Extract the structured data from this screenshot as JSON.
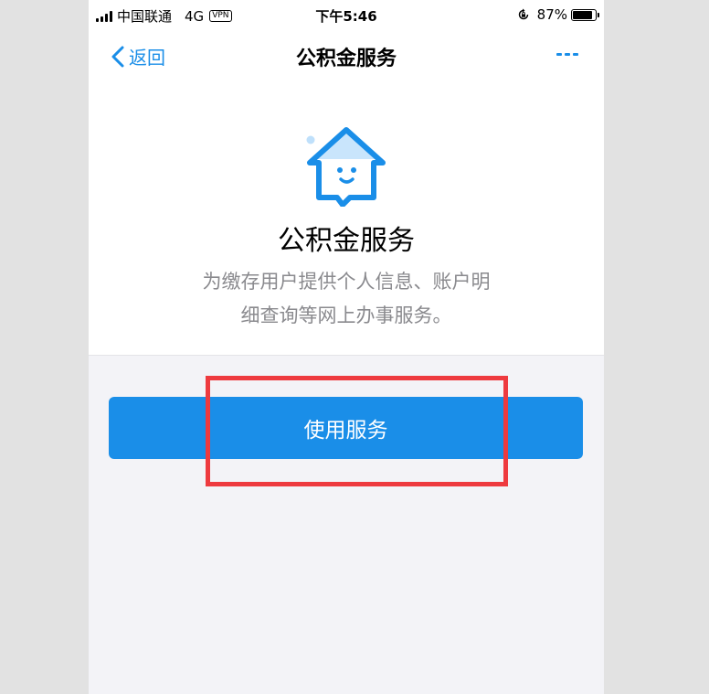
{
  "status_bar": {
    "carrier": "中国联通",
    "network": "4G",
    "vpn": "VPN",
    "time": "下午5:46",
    "battery_percent": "87%",
    "battery_level": 0.87,
    "icons": [
      "signal-icon",
      "rotation-lock-icon",
      "battery-icon"
    ]
  },
  "nav": {
    "back_label": "返回",
    "title": "公积金服务",
    "back_icon": "chevron-left-icon",
    "more_icon": "more-icon"
  },
  "service": {
    "logo_icon": "house-chat-icon",
    "title": "公积金服务",
    "description_lines": [
      "为缴存用户提供个人信息、账户明",
      "细查询等网上办事服务。"
    ]
  },
  "action": {
    "use_label": "使用服务"
  },
  "colors": {
    "accent": "#1a8ee8",
    "highlight": "#ee3a3f",
    "page_background": "#f3f3f7"
  }
}
